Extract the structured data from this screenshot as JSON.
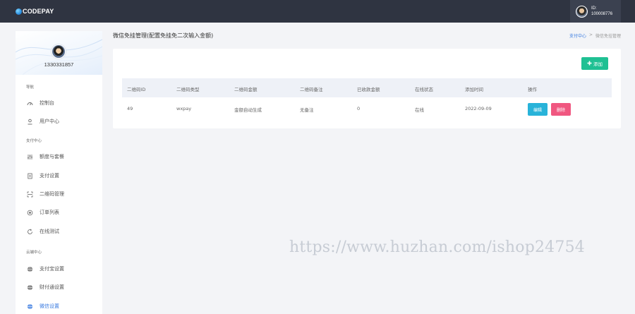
{
  "topbar": {
    "logo_text": "CODEPAY",
    "user_id_label": "ID:",
    "user_id_value": "100008776"
  },
  "sidebar": {
    "username": "1330331857",
    "sections": [
      {
        "title": "导航",
        "items": [
          {
            "label": "控制台",
            "icon": "dashboard-icon"
          },
          {
            "label": "用户中心",
            "icon": "user-icon"
          }
        ]
      },
      {
        "title": "支付中心",
        "items": [
          {
            "label": "额度与套餐",
            "icon": "sliders-icon"
          },
          {
            "label": "支付设置",
            "icon": "document-icon"
          },
          {
            "label": "二维码管理",
            "icon": "qrcode-icon"
          },
          {
            "label": "订单列表",
            "icon": "list-icon"
          },
          {
            "label": "在线测试",
            "icon": "refresh-icon"
          }
        ]
      },
      {
        "title": "云端中心",
        "items": [
          {
            "label": "支付宝设置",
            "icon": "globe-icon"
          },
          {
            "label": "财付通设置",
            "icon": "globe-icon"
          },
          {
            "label": "微信设置",
            "icon": "globe-icon",
            "active": true
          }
        ]
      }
    ]
  },
  "main": {
    "title": "微信免挂管理(配置免挂免二次输入金额)",
    "breadcrumb": [
      "支付中心",
      ">",
      "微信免挂管理"
    ],
    "add_button": "添加",
    "table": {
      "headers": [
        "二维码ID",
        "二维码类型",
        "二维码金额",
        "二维码备注",
        "已收款金额",
        "在线状态",
        "添加时间",
        "操作"
      ],
      "rows": [
        [
          "49",
          "wxpay",
          "金额自动生成",
          "无备注",
          "0",
          "在线",
          "2022-09-09"
        ]
      ],
      "edit_label": "编辑",
      "delete_label": "删除"
    }
  },
  "watermark": "https://www.huzhan.com/ishop24754",
  "colors": {
    "topbar": "#2f3441",
    "accent": "#3a7be0",
    "add_button": "#1fc093",
    "edit_button": "#28b3d9",
    "delete_button": "#f05780"
  }
}
